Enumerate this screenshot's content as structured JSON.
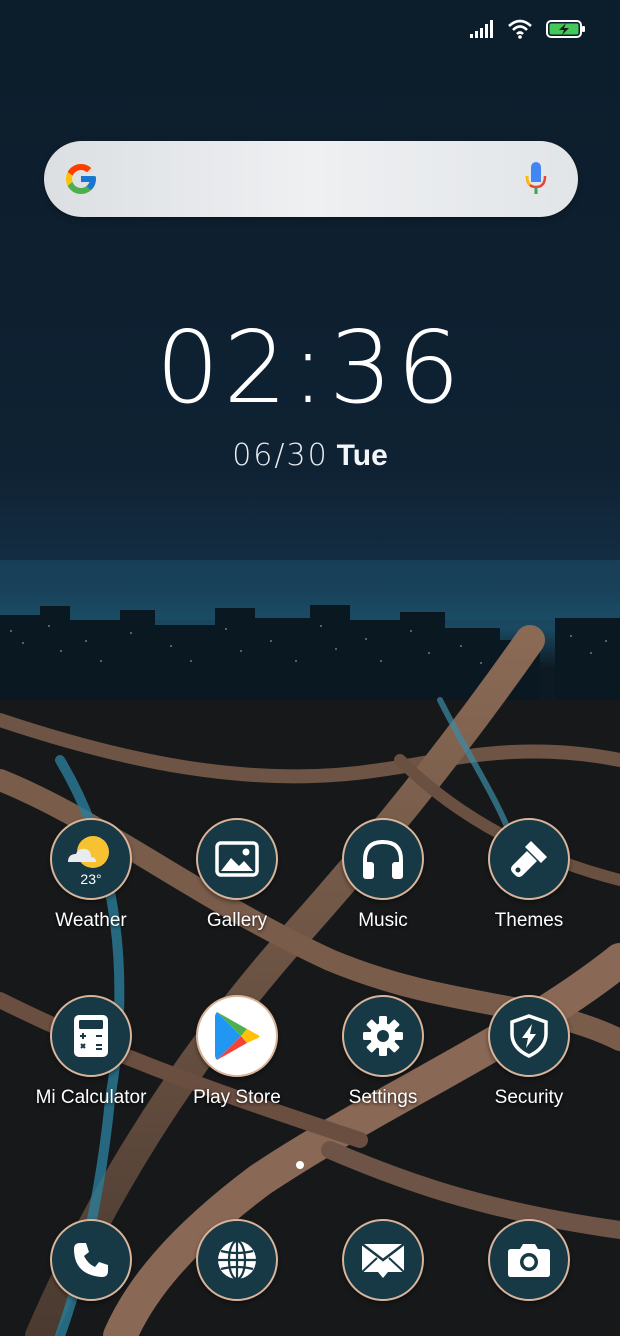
{
  "status_bar": {
    "signal_icon": "signal-bars-icon",
    "wifi_icon": "wifi-icon",
    "battery_icon": "battery-charging-icon",
    "battery_color": "#43c95a"
  },
  "search": {
    "logo_icon": "google-g-icon",
    "mic_icon": "microphone-icon",
    "placeholder": ""
  },
  "clock": {
    "time": "02:36",
    "date": "06/30",
    "weekday": "Tue"
  },
  "apps_row1": [
    {
      "label": "Weather",
      "icon": "weather-sun-cloud-icon",
      "temp": "23°"
    },
    {
      "label": "Gallery",
      "icon": "image-icon"
    },
    {
      "label": "Music",
      "icon": "headphones-icon"
    },
    {
      "label": "Themes",
      "icon": "paintbrush-icon"
    }
  ],
  "apps_row2": [
    {
      "label": "Mi Calculator",
      "icon": "calculator-icon"
    },
    {
      "label": "Play Store",
      "icon": "play-store-icon"
    },
    {
      "label": "Settings",
      "icon": "gear-icon"
    },
    {
      "label": "Security",
      "icon": "shield-bolt-icon"
    }
  ],
  "dock": [
    {
      "icon": "phone-icon"
    },
    {
      "icon": "globe-icon"
    },
    {
      "icon": "mail-icon"
    },
    {
      "icon": "camera-icon"
    }
  ],
  "colors": {
    "icon_ring": "#d8b49a",
    "icon_fill": "#173845",
    "sky_top": "#0d1f2d"
  }
}
